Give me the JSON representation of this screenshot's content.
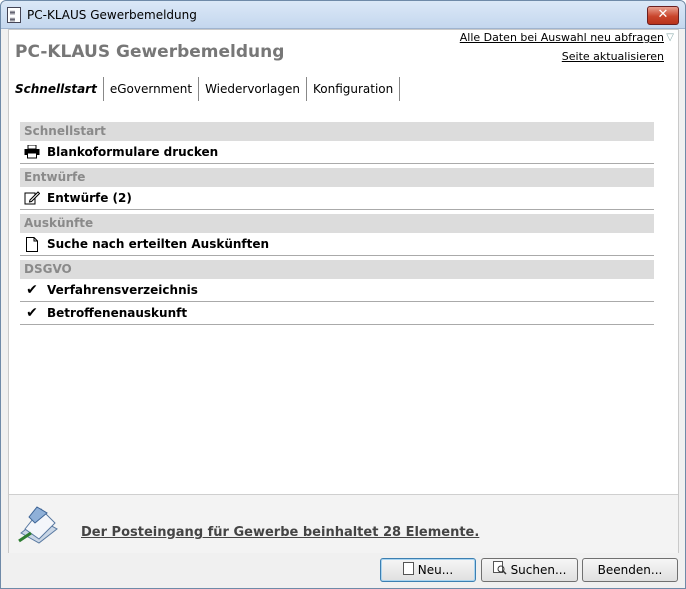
{
  "window": {
    "title": "PC-KLAUS Gewerbemeldung",
    "close_label": "✕"
  },
  "header": {
    "page_title": "PC-KLAUS Gewerbemeldung",
    "link_refresh_all": "Alle Daten bei Auswahl neu abfragen",
    "link_refresh_page": "Seite aktualisieren"
  },
  "tabs": [
    "Schnellstart",
    "eGovernment",
    "Wiedervorlagen",
    "Konfiguration"
  ],
  "sections": [
    {
      "title": "Schnellstart",
      "items": [
        {
          "label": "Blankoformulare drucken",
          "icon": "printer-icon"
        }
      ]
    },
    {
      "title": "Entwürfe",
      "items": [
        {
          "label": "Entwürfe (2)",
          "icon": "edit-icon"
        }
      ]
    },
    {
      "title": "Auskünfte",
      "items": [
        {
          "label": "Suche nach erteilten Auskünften",
          "icon": "document-icon"
        }
      ]
    },
    {
      "title": "DSGVO",
      "items": [
        {
          "label": "Verfahrensverzeichnis",
          "icon": "checkmark-icon"
        },
        {
          "label": "Betroffenenauskunft",
          "icon": "checkmark-icon"
        }
      ]
    }
  ],
  "footer": {
    "inbox_text": "Der Posteingang für Gewerbe beinhaltet 28 Elemente."
  },
  "buttons": {
    "new": "Neu...",
    "search": "Suchen...",
    "exit": "Beenden..."
  }
}
